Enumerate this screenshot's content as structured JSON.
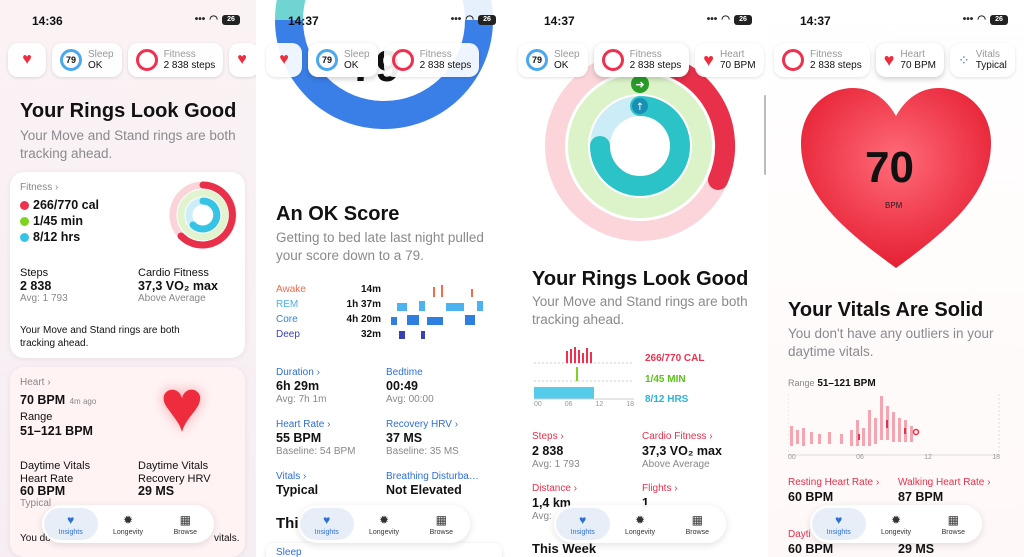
{
  "status": {
    "time1": "14:36",
    "time2": "14:37",
    "time3": "14:37",
    "time4": "14:37",
    "battery": "26"
  },
  "chips": {
    "sleep": {
      "title": "Sleep",
      "value": "OK",
      "score": "79"
    },
    "fitness": {
      "title": "Fitness",
      "value": "2 838 steps"
    },
    "heart": {
      "title": "Heart",
      "value": "70 BPM"
    },
    "vitals": {
      "title": "Vitals",
      "value": "Typical"
    }
  },
  "panel1": {
    "title": "Your Rings Look Good",
    "subtitle": "Your Move and Stand rings are both tracking ahead.",
    "fitness_card": {
      "header": "Fitness",
      "move": "266/770 cal",
      "exercise": "1/45 min",
      "stand": "8/12 hrs",
      "steps_label": "Steps",
      "steps_value": "2 838",
      "steps_avg": "Avg: 1 793",
      "cardio_label": "Cardio Fitness",
      "cardio_value": "37,3 VO₂ max",
      "cardio_note": "Above Average",
      "footer": "Your Move and Stand rings are both tracking ahead."
    },
    "heart_card": {
      "header": "Heart",
      "bpm": "70 BPM",
      "ago": "4m ago",
      "range_label": "Range",
      "range_value": "51–121 BPM",
      "daytime_label": "Daytime Vitals",
      "hr_label": "Heart Rate",
      "hr_value": "60 BPM",
      "hr_note": "Typical",
      "daytime_label2": "Daytime Vitals",
      "hrv_label": "Recovery HRV",
      "hrv_value": "29 MS",
      "footer_left": "You do",
      "footer_right": "vitals."
    }
  },
  "panel2": {
    "score": "79",
    "title": "An OK Score",
    "subtitle": "Getting to bed late last night pulled your score down to a 79.",
    "stages": [
      {
        "name": "Awake",
        "value": "14m",
        "color": "#f26b4c"
      },
      {
        "name": "REM",
        "value": "1h 37m",
        "color": "#4ab3f0"
      },
      {
        "name": "Core",
        "value": "4h 20m",
        "color": "#2f7fe0"
      },
      {
        "name": "Deep",
        "value": "32m",
        "color": "#3a3fb8"
      }
    ],
    "duration_label": "Duration",
    "duration_value": "6h 29m",
    "duration_avg": "Avg: 7h 1m",
    "bedtime_label": "Bedtime",
    "bedtime_value": "00:49",
    "bedtime_avg": "Avg: 00:00",
    "hr_label": "Heart Rate",
    "hr_value": "55 BPM",
    "hr_base": "Baseline: 54 BPM",
    "hrv_label": "Recovery HRV",
    "hrv_value": "37 MS",
    "hrv_base": "Baseline: 35 MS",
    "vitals_label": "Vitals",
    "vitals_value": "Typical",
    "breath_label": "Breathing Disturba…",
    "breath_value": "Not Elevated",
    "peek": "Thi",
    "sleep_row": "Sleep"
  },
  "panel3": {
    "title": "Your Rings Look Good",
    "subtitle": "Your Move and Stand rings are both tracking ahead.",
    "move": "266/770 CAL",
    "exercise": "1/45 MIN",
    "stand": "8/12 HRS",
    "axis": [
      "00",
      "06",
      "12",
      "18"
    ],
    "steps_label": "Steps",
    "steps_value": "2 838",
    "steps_avg": "Avg: 1 793",
    "cardio_label": "Cardio Fitness",
    "cardio_value": "37,3 VO₂ max",
    "cardio_note": "Above Average",
    "distance_label": "Distance",
    "distance_value": "1,4 km",
    "distance_avg": "Avg:",
    "flights_label": "Flights",
    "flights_value": "1",
    "week": "This Week"
  },
  "panel4": {
    "bpm": "70",
    "bpm_unit": "BPM",
    "title": "Your Vitals Are Solid",
    "subtitle": "You don't have any outliers in your daytime vitals.",
    "range_label": "Range",
    "range_value": "51–121 BPM",
    "axis": [
      "00",
      "06",
      "12",
      "18"
    ],
    "resting_label": "Resting Heart Rate",
    "resting_value": "60 BPM",
    "walking_label": "Walking Heart Rate",
    "walking_value": "87 BPM",
    "peek_left": "Dayti",
    "peek_left_value": "60 BPM",
    "peek_right_value": "29 MS"
  },
  "tabs": {
    "insights": "Insights",
    "longevity": "Longevity",
    "browse": "Browse"
  },
  "colors": {
    "move": "#f0304e",
    "exercise": "#7ed321",
    "stand": "#36c3e6",
    "accent": "#2e6fd8",
    "heart": "#ee2c3e"
  }
}
